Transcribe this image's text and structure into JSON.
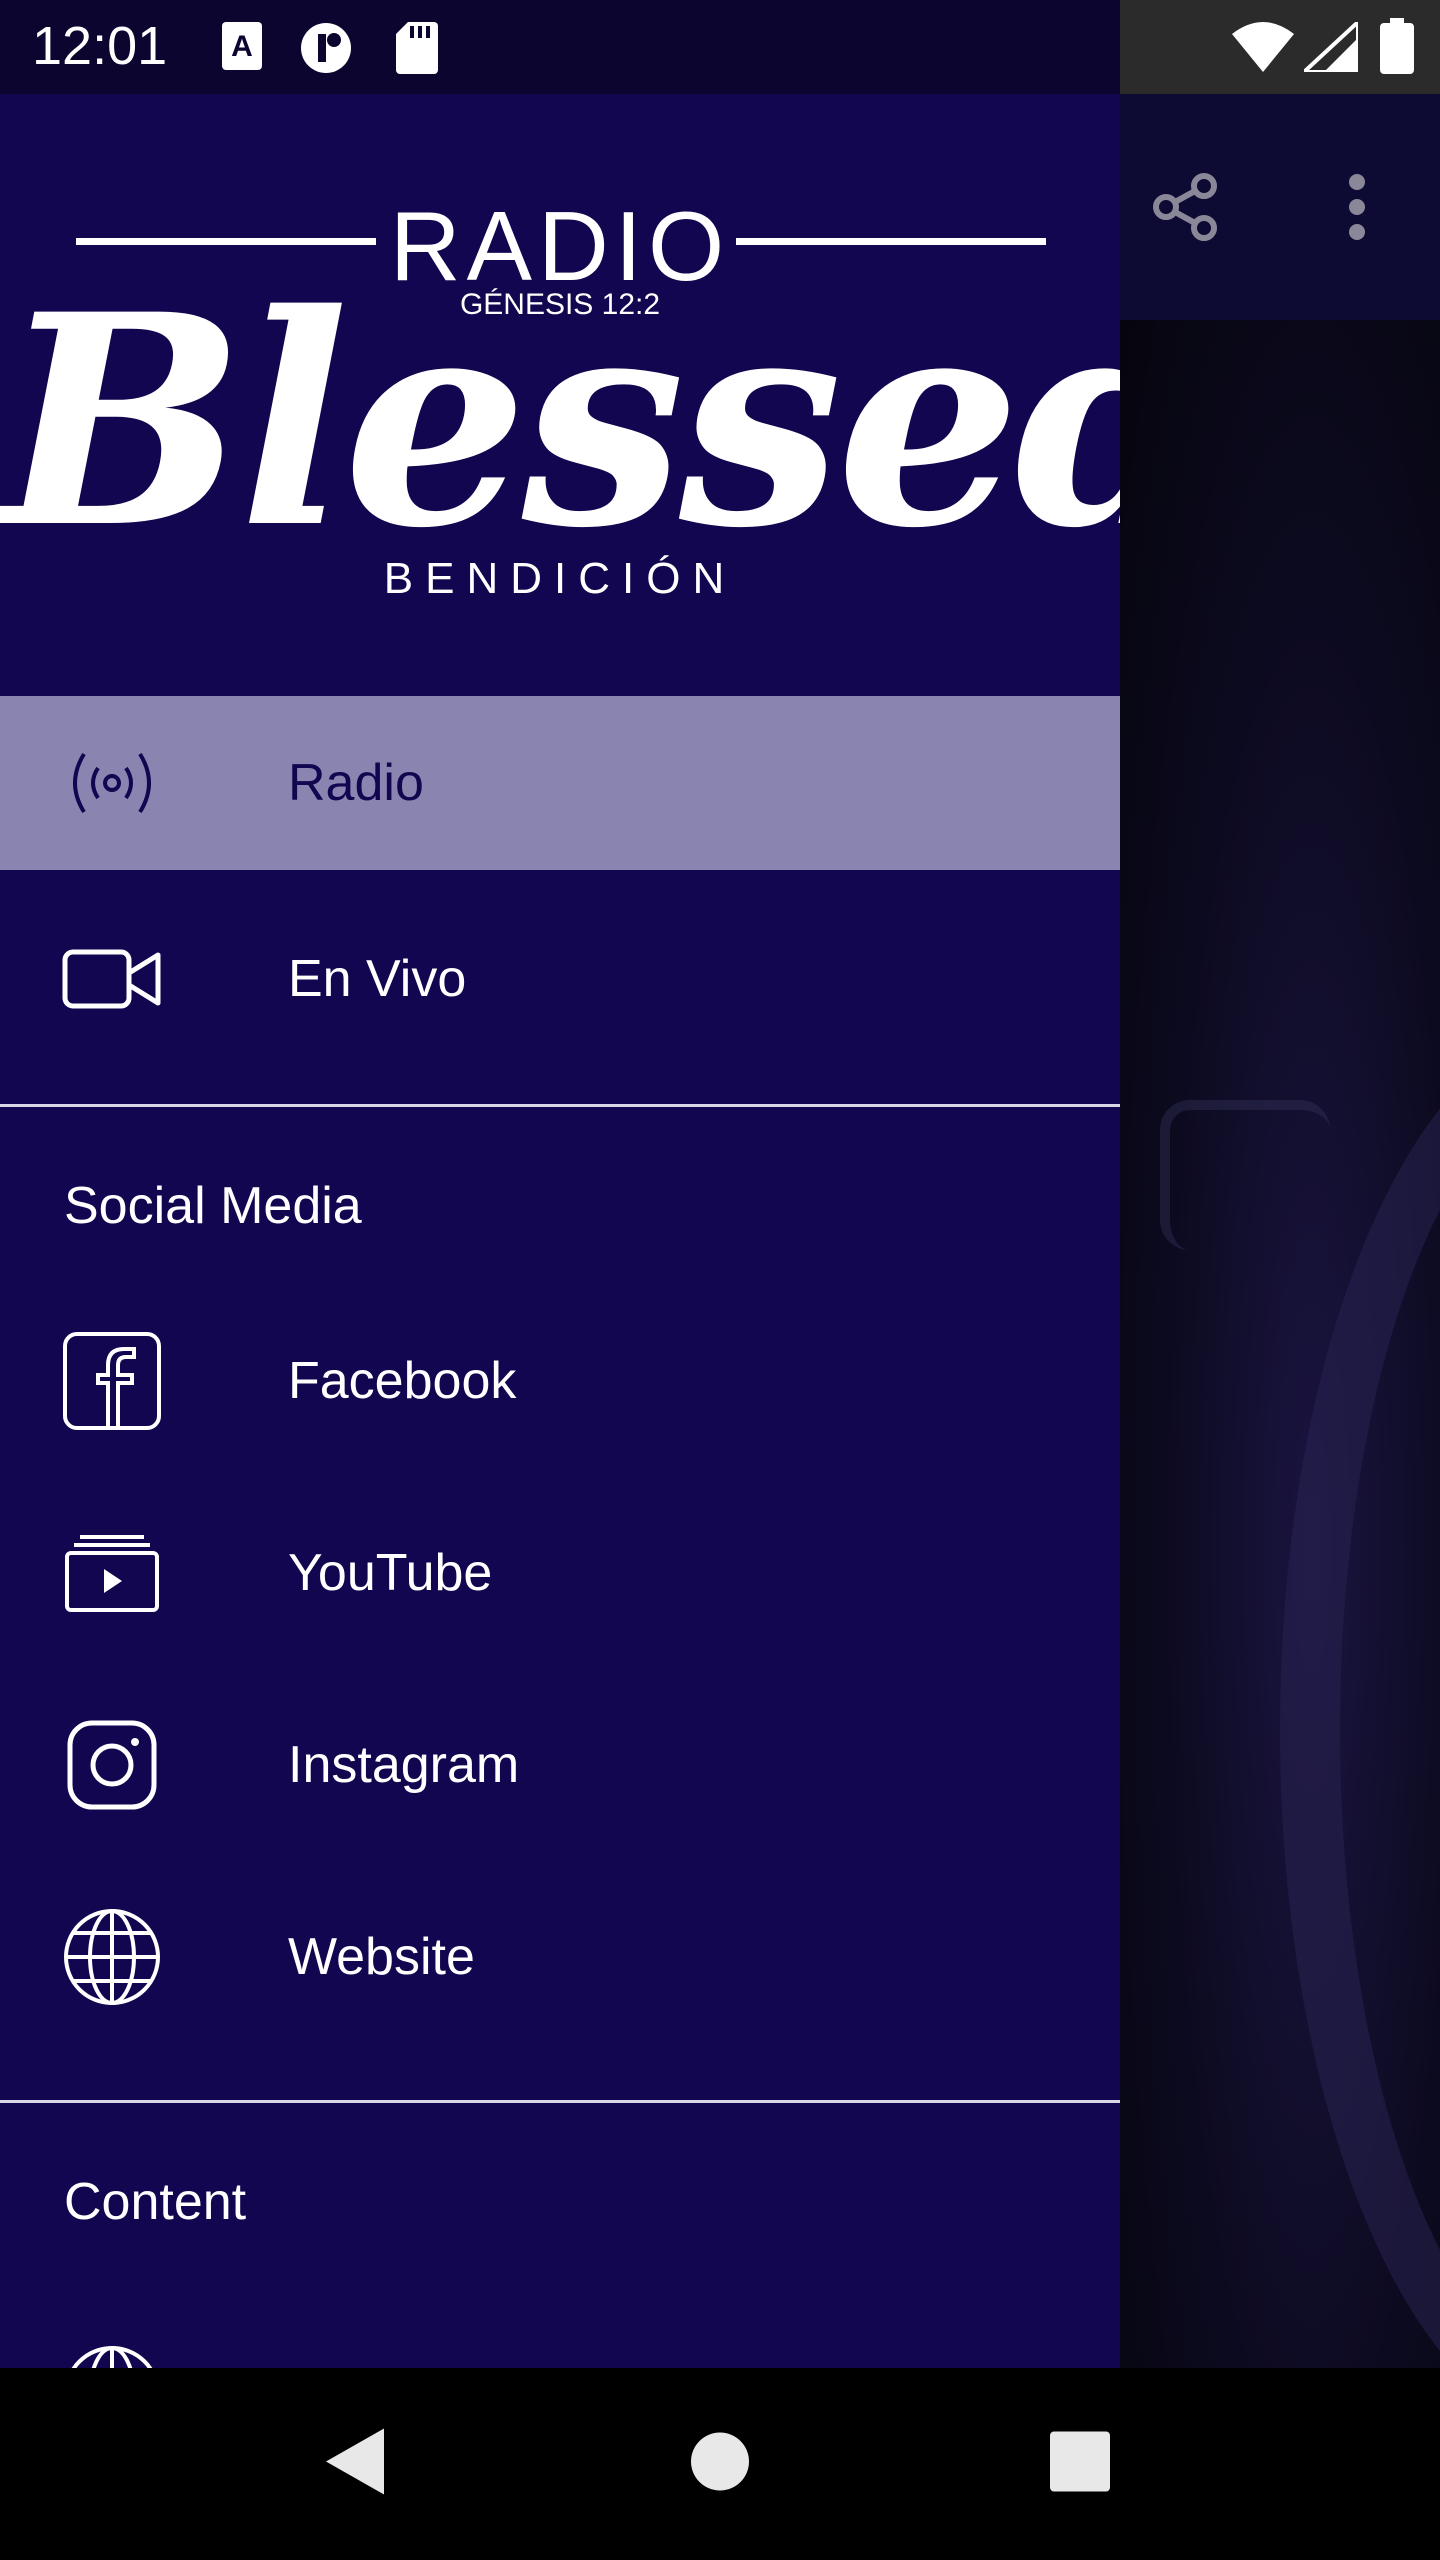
{
  "status_bar": {
    "time": "12:01",
    "left_icons": [
      "font-a-icon",
      "app-circle-icon",
      "sd-card-icon"
    ],
    "right_icons": [
      "wifi-icon",
      "signal-icon",
      "battery-icon"
    ]
  },
  "drawer": {
    "logo": {
      "top_word": "RADIO",
      "verse": "GÉNESIS 12:2",
      "script_word": "Blessed",
      "bottom_word": "BENDICIÓN"
    },
    "primary_items": [
      {
        "label": "Radio",
        "icon": "radio-broadcast-icon",
        "selected": true
      },
      {
        "label": "En Vivo",
        "icon": "video-camera-icon",
        "selected": false
      }
    ],
    "social_section_title": "Social Media",
    "social_items": [
      {
        "label": "Facebook",
        "icon": "facebook-icon"
      },
      {
        "label": "YouTube",
        "icon": "youtube-icon"
      },
      {
        "label": "Instagram",
        "icon": "instagram-icon"
      },
      {
        "label": "Website",
        "icon": "globe-icon"
      }
    ],
    "content_section_title": "Content"
  },
  "background_app": {
    "toolbar_icons": [
      "share-icon",
      "more-vert-icon"
    ]
  },
  "nav_bar": {
    "buttons": [
      "back-icon",
      "home-icon",
      "recents-icon"
    ]
  },
  "colors": {
    "drawer_bg": "#11064f",
    "selected_bg": "#8a84b0",
    "text": "#ffffff"
  }
}
